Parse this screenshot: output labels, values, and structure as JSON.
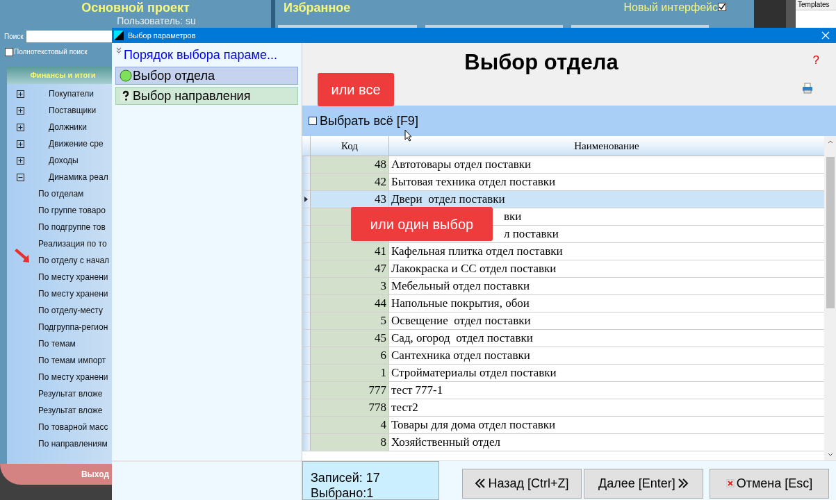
{
  "app": {
    "title": "Основной проект",
    "user": "Пользователь: su",
    "favorites_title": "Избранное",
    "new_interface": {
      "label": "Новый интерфейс",
      "checked": true
    },
    "side_tab": "Templates"
  },
  "sidebar": {
    "search_label": "Поиск",
    "fulltext": {
      "label": "Полнотекстовый поиск",
      "checked": false
    },
    "section": "Финансы и итоги",
    "tree": [
      {
        "label": "Покупатели",
        "expanded": false
      },
      {
        "label": "Поставщики",
        "expanded": false
      },
      {
        "label": "Должники",
        "expanded": false
      },
      {
        "label": "Движение сре",
        "expanded": false
      },
      {
        "label": "Доходы",
        "expanded": false
      },
      {
        "label": "Динамика реал",
        "expanded": true,
        "children": [
          {
            "label": "По отделам"
          },
          {
            "label": "По группе товаро"
          },
          {
            "label": "По подгруппе тов"
          },
          {
            "label": "Реализация по то"
          },
          {
            "label": "По отделу с начал"
          },
          {
            "label": "По месту хранени"
          },
          {
            "label": "По месту хранени"
          },
          {
            "label": "По отделу-месту"
          },
          {
            "label": "Подгруппа-регион"
          },
          {
            "label": "По темам"
          },
          {
            "label": "По темам импорт"
          },
          {
            "label": "По месту хранени"
          },
          {
            "label": "Результат вложе"
          },
          {
            "label": "Результат вложе"
          },
          {
            "label": "По товарной масс"
          },
          {
            "label": "По направлениям"
          }
        ]
      }
    ],
    "exit": "Выход"
  },
  "dialog": {
    "title": "Выбор параметров",
    "steps_title": "Порядок выбора параме...",
    "steps": [
      {
        "label": "Выбор отдела",
        "kind": "current",
        "selected": true
      },
      {
        "label": "Выбор направления",
        "kind": "pending",
        "selected": false
      }
    ],
    "heading": "Выбор отдела",
    "help": "?",
    "callout_all": "или все",
    "callout_one": "или один выбор",
    "select_all": {
      "label": "Выбрать всё [F9]",
      "checked": false
    },
    "table": {
      "columns": [
        "Код",
        "Наименование"
      ],
      "rows": [
        {
          "code": "48",
          "name": "Автотовары отдел поставки",
          "selected": false
        },
        {
          "code": "42",
          "name": "Бытовая техника отдел поставки",
          "selected": false
        },
        {
          "code": "43",
          "name": "Двери  отдел поставки",
          "selected": true
        },
        {
          "name": "вки",
          "kind": "covered",
          "selected": false
        },
        {
          "name": "л поставки",
          "kind": "covered",
          "selected": false
        },
        {
          "code": "41",
          "name": "Кафельная плитка отдел поставки",
          "selected": false
        },
        {
          "code": "47",
          "name": "Лакокраска и СС отдел поставки",
          "selected": false
        },
        {
          "code": "3",
          "name": "Мебельный отдел поставки",
          "selected": false
        },
        {
          "code": "44",
          "name": "Напольные покрытия, обои",
          "selected": false
        },
        {
          "code": "5",
          "name": "Освещение  отдел поставки",
          "selected": false
        },
        {
          "code": "45",
          "name": "Сад, огород  отдел поставки",
          "selected": false
        },
        {
          "code": "6",
          "name": "Сантехника отдел поставки",
          "selected": false
        },
        {
          "code": "1",
          "name": "Стройматериалы отдел поставки",
          "selected": false
        },
        {
          "code": "777",
          "name": "тест 777-1",
          "selected": false
        },
        {
          "code": "778",
          "name": "тест2",
          "selected": false
        },
        {
          "code": "4",
          "name": "Товары для дома отдел поставки",
          "selected": false
        },
        {
          "code": "8",
          "name": "Хозяйственный отдел",
          "selected": false
        }
      ]
    },
    "records": "Записей: 17",
    "selected_count": "Выбрано:1",
    "buttons": [
      {
        "label": "Назад [Ctrl+Z]",
        "kind": "back"
      },
      {
        "label": "Далее [Enter]",
        "kind": "next"
      },
      {
        "label": "Отмена [Esc]",
        "kind": "cancel"
      }
    ]
  }
}
